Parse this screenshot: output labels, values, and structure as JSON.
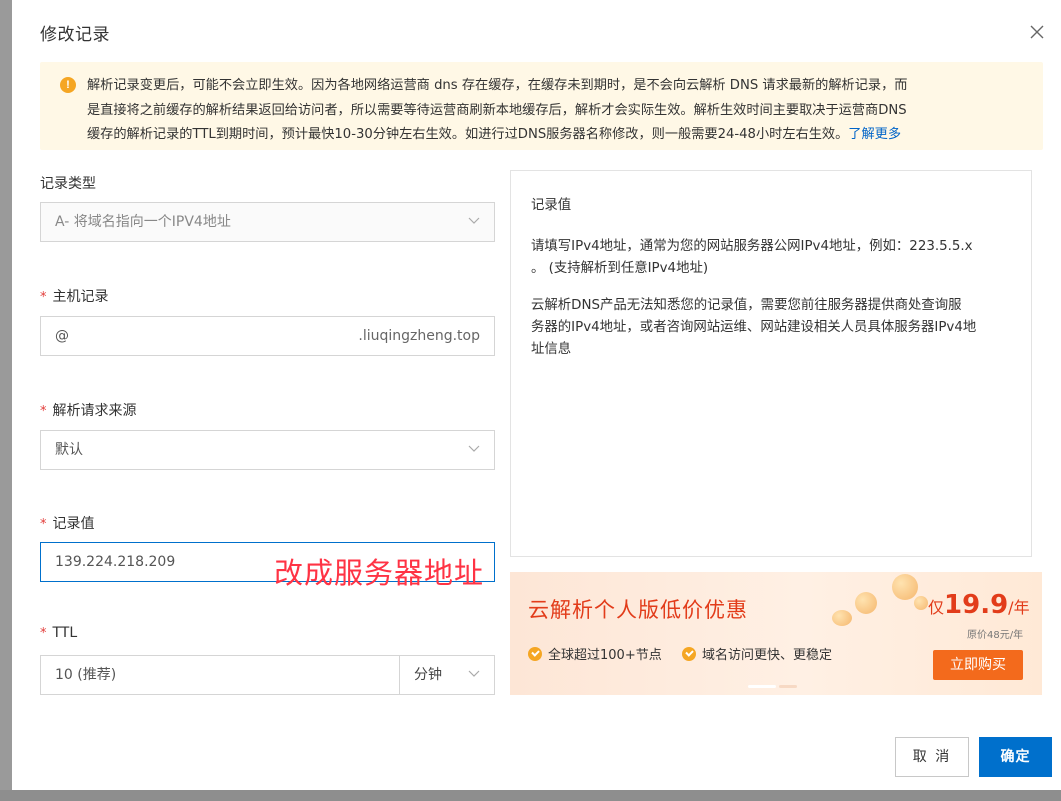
{
  "dialog": {
    "title": "修改记录"
  },
  "notice": {
    "icon": "warning-icon",
    "line1": "解析记录变更后，可能不会立即生效。因为各地网络运营商 dns 存在缓存，在缓存未到期时，是不会向云解析 DNS 请求最新的解析记录，而",
    "line2": "是直接将之前缓存的解析结果返回给访问者，所以需要等待运营商刷新本地缓存后，解析才会实际生效。解析生效时间主要取决于运营商DNS",
    "line3": "缓存的解析记录的TTL到期时间，预计最快10-30分钟左右生效。如进行过DNS服务器名称修改，则一般需要24-48小时左右生效。",
    "link": "了解更多"
  },
  "form": {
    "record_type": {
      "label": "记录类型",
      "value": "A- 将域名指向一个IPV4地址"
    },
    "host": {
      "required": "*",
      "label": "主机记录",
      "value": "@",
      "suffix": ".liuqingzheng.top"
    },
    "source": {
      "required": "*",
      "label": "解析请求来源",
      "value": "默认"
    },
    "record_value": {
      "required": "*",
      "label": "记录值",
      "value": "139.224.218.209"
    },
    "ttl": {
      "required": "*",
      "label": "TTL",
      "value": "10 (推荐)",
      "unit": "分钟"
    }
  },
  "annotation": "改成服务器地址",
  "help": {
    "title": "记录值",
    "p1_line1": "请填写IPv4地址，通常为您的网站服务器公网IPv4地址，例如：223.5.5.x",
    "p1_line2": "。 (支持解析到任意IPv4地址)",
    "p2_line1": "云解析DNS产品无法知悉您的记录值，需要您前往服务器提供商处查询服",
    "p2_line2": "务器的IPv4地址，或者咨询网站运维、网站建设相关人员具体服务器IPv4地",
    "p2_line3": "址信息"
  },
  "promo": {
    "title": "云解析个人版低价优惠",
    "price_prefix": "仅",
    "price": "19.9",
    "price_suffix": "/年",
    "original_price": "原价48元/年",
    "feature1": "全球超过100+节点",
    "feature2": "域名访问更快、更稳定",
    "buy": "立即购买",
    "accent_color": "#e23c1a"
  },
  "buttons": {
    "cancel": "取 消",
    "ok": "确定"
  },
  "colors": {
    "primary": "#0070cc",
    "notice_bg": "#fff8e6",
    "required": "#e23c39",
    "annotation": "#ff3344"
  }
}
